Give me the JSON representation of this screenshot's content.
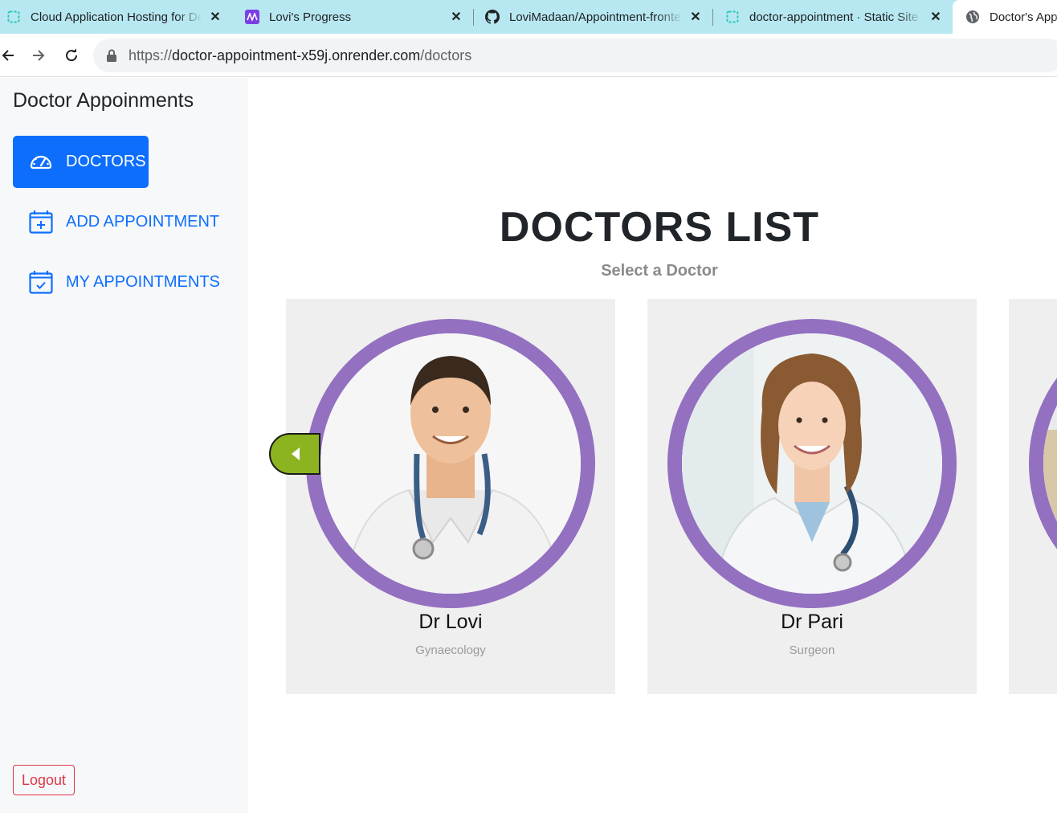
{
  "browser": {
    "tabs": [
      {
        "title": "Cloud Application Hosting for De",
        "favicon": "render-icon"
      },
      {
        "title": "Lovi's Progress",
        "favicon": "mural-icon"
      },
      {
        "title": "LoviMadaan/Appointment-fronte",
        "favicon": "github-icon"
      },
      {
        "title": "doctor-appointment · Static Site",
        "favicon": "render-icon"
      },
      {
        "title": "Doctor's App",
        "favicon": "globe-icon"
      }
    ],
    "url": {
      "scheme": "https://",
      "host": "doctor-appointment-x59j.onrender.com",
      "path": "/doctors"
    }
  },
  "sidebar": {
    "brand": "Doctor Appoinments",
    "items": [
      {
        "label": "DOCTORS",
        "icon": "dashboard-icon",
        "active": true
      },
      {
        "label": "ADD APPOINTMENT",
        "icon": "calendar-plus-icon",
        "active": false
      },
      {
        "label": "MY APPOINTMENTS",
        "icon": "calendar-check-icon",
        "active": false
      }
    ],
    "logout_label": "Logout"
  },
  "main": {
    "heading": "DOCTORS LIST",
    "subheading": "Select a Doctor",
    "doctors": [
      {
        "name": "Dr Lovi",
        "specialty": "Gynaecology"
      },
      {
        "name": "Dr Pari",
        "specialty": "Surgeon"
      }
    ]
  },
  "colors": {
    "accent": "#0d6efd",
    "ring": "#9470c1",
    "card_bg": "#efefef",
    "arrow": "#8cb420",
    "logout": "#dc3545"
  }
}
